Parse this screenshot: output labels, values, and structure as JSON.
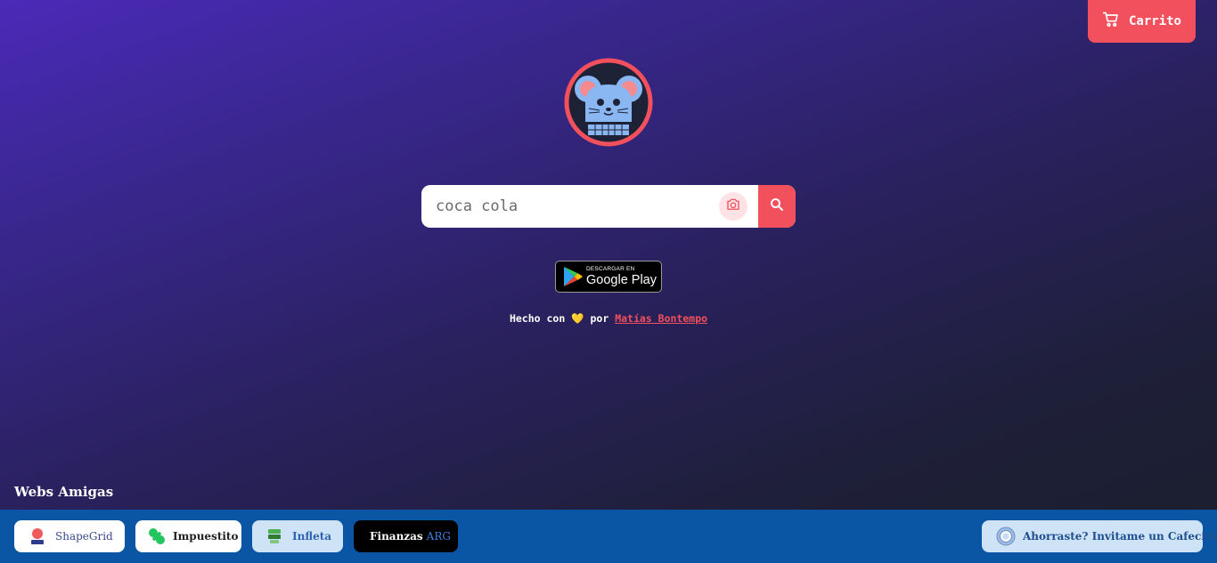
{
  "header": {
    "cart_label": "Carrito"
  },
  "search": {
    "value": "coca cola"
  },
  "store_badge": {
    "small": "DESCARGAR EN",
    "big": "Google Play"
  },
  "credits": {
    "made_with": "Hecho con",
    "heart": "💛",
    "by": "por",
    "author": "Matías Bontempo"
  },
  "friends": {
    "title": "Webs Amigas",
    "links": [
      {
        "label": "ShapeGrid"
      },
      {
        "label": "Impuestito"
      },
      {
        "label": "Infleta"
      },
      {
        "label": "Finanzas",
        "accent": "ARG"
      }
    ],
    "coffee_label": "Ahorraste? Invitame un Cafecito"
  },
  "colors": {
    "accent": "#f2505d",
    "footer": "#0a56a4",
    "bg_top": "#4a2ab8",
    "bg_bottom": "#1b1e2e"
  }
}
